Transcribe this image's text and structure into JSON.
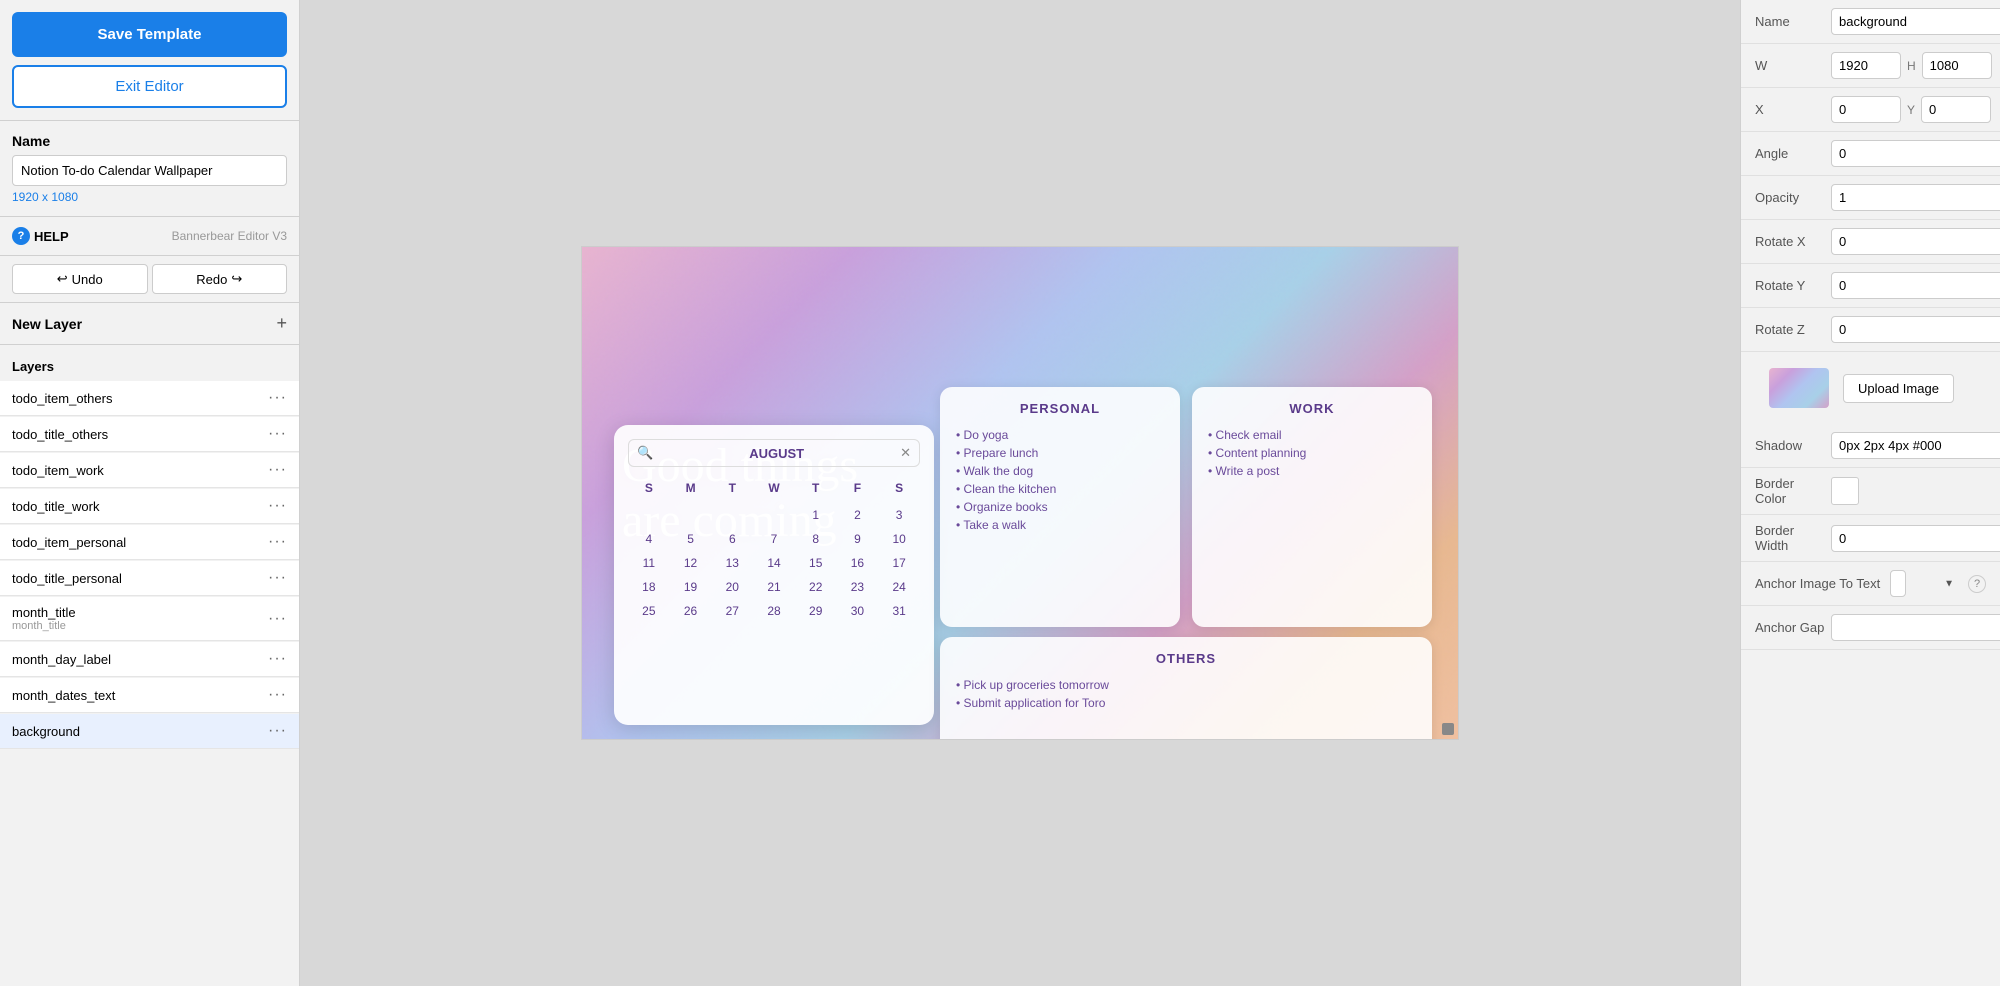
{
  "leftPanel": {
    "saveTemplateLabel": "Save Template",
    "exitEditorLabel": "Exit Editor",
    "nameLabel": "Name",
    "nameValue": "Notion To-do Calendar Wallpaper",
    "dimensionText": "1920 x 1080",
    "helpLabel": "HELP",
    "editorVersion": "Bannerbear Editor V3",
    "undoLabel": "Undo",
    "redoLabel": "Redo",
    "newLayerLabel": "New Layer",
    "layersLabel": "Layers",
    "layers": [
      {
        "id": "todo_item_others",
        "name": "todo_item_others",
        "sub": ""
      },
      {
        "id": "todo_title_others",
        "name": "todo_title_others",
        "sub": ""
      },
      {
        "id": "todo_item_work",
        "name": "todo_item_work",
        "sub": ""
      },
      {
        "id": "todo_title_work",
        "name": "todo_title_work",
        "sub": ""
      },
      {
        "id": "todo_item_personal",
        "name": "todo_item_personal",
        "sub": ""
      },
      {
        "id": "todo_title_personal",
        "name": "todo_title_personal",
        "sub": ""
      },
      {
        "id": "month_title",
        "name": "month_title",
        "sub": "month_title"
      },
      {
        "id": "month_day_label",
        "name": "month_day_label",
        "sub": ""
      },
      {
        "id": "month_dates_text",
        "name": "month_dates_text",
        "sub": ""
      },
      {
        "id": "background",
        "name": "background",
        "sub": ""
      }
    ]
  },
  "canvas": {
    "goodThingsLine1": "Good things",
    "goodThingsLine2": "are coming",
    "calendar": {
      "monthName": "AUGUST",
      "dayHeaders": [
        "S",
        "M",
        "T",
        "W",
        "T",
        "F",
        "S"
      ],
      "rows": [
        [
          "",
          "",
          "",
          "",
          "1",
          "2",
          "3"
        ],
        [
          "4",
          "5",
          "6",
          "7",
          "8",
          "9",
          "10"
        ],
        [
          "11",
          "12",
          "13",
          "14",
          "15",
          "16",
          "17"
        ],
        [
          "18",
          "19",
          "20",
          "21",
          "22",
          "23",
          "24"
        ],
        [
          "25",
          "26",
          "27",
          "28",
          "29",
          "30",
          "31"
        ]
      ]
    },
    "personal": {
      "title": "PERSONAL",
      "items": [
        "Do yoga",
        "Prepare lunch",
        "Walk the dog",
        "Clean the kitchen",
        "Organize books",
        "Take a walk"
      ]
    },
    "work": {
      "title": "WORK",
      "items": [
        "Check email",
        "Content planning",
        "Write a post"
      ]
    },
    "others": {
      "title": "OTHERS",
      "items": [
        "Pick up groceries tomorrow",
        "Submit application for Toro"
      ]
    }
  },
  "rightPanel": {
    "nameLabel": "Name",
    "nameValue": "background",
    "wLabel": "W",
    "wValue": "1920",
    "hLabel": "H",
    "hValue": "1080",
    "xLabel": "X",
    "xValue": "0",
    "yLabel": "Y",
    "yValue": "0",
    "angleLabel": "Angle",
    "angleValue": "0",
    "opacityLabel": "Opacity",
    "opacityValue": "1",
    "rotateXLabel": "Rotate X",
    "rotateXValue": "0",
    "rotateYLabel": "Rotate Y",
    "rotateYValue": "0",
    "rotateZLabel": "Rotate Z",
    "rotateZValue": "0",
    "uploadImageLabel": "Upload Image",
    "shadowLabel": "Shadow",
    "shadowValue": "0px 2px 4px #000",
    "borderColorLabel": "Border Color",
    "borderWidthLabel": "Border Width",
    "borderWidthValue": "0",
    "anchorImageToTextLabel": "Anchor Image To Text",
    "anchorImageToTextValue": "",
    "anchorGapLabel": "Anchor Gap",
    "anchorGapValue": ""
  }
}
